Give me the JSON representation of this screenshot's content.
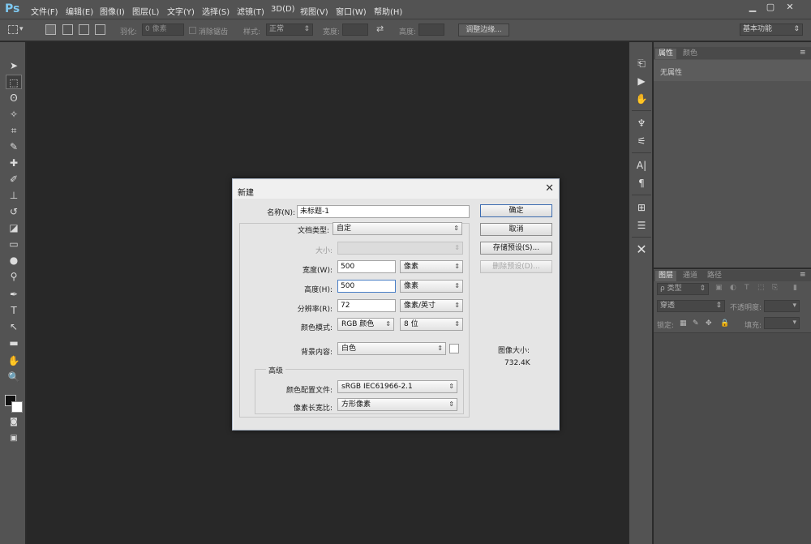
{
  "app": {
    "logo": "Ps",
    "menu": [
      "文件(F)",
      "编辑(E)",
      "图像(I)",
      "图层(L)",
      "文字(Y)",
      "选择(S)",
      "滤镜(T)",
      "3D(D)",
      "视图(V)",
      "窗口(W)",
      "帮助(H)"
    ],
    "window_buttons": [
      "▁",
      "▢",
      "✕"
    ]
  },
  "options_bar": {
    "feather_label": "羽化:",
    "feather_value": "0 像素",
    "antialias_label": "消除锯齿",
    "style_label": "样式:",
    "style_value": "正常",
    "width_label": "宽度:",
    "height_label": "高度:",
    "refine_edge_button": "调整边缘...",
    "workspace": "基本功能"
  },
  "right_panel": {
    "tabs_top": [
      "属性",
      "颜色"
    ],
    "properties_empty": "无属性",
    "tabs_layers": [
      "图层",
      "通道",
      "路径"
    ],
    "kind_filter": "ρ 类型",
    "blend_mode": "穿透",
    "opacity_label": "不透明度:",
    "lock_label": "锁定:",
    "fill_label": "填充:"
  },
  "dialog": {
    "title": "新建",
    "name_label": "名称(N):",
    "name_value": "未标题-1",
    "doc_type_label": "文档类型:",
    "doc_type_value": "自定",
    "size_label": "大小:",
    "width_label": "宽度(W):",
    "width_value": "500",
    "width_unit": "像素",
    "height_label": "高度(H):",
    "height_value": "500",
    "height_unit": "像素",
    "resolution_label": "分辨率(R):",
    "resolution_value": "72",
    "resolution_unit": "像素/英寸",
    "color_mode_label": "颜色模式:",
    "color_mode_value": "RGB 颜色",
    "bit_depth_value": "8 位",
    "background_label": "背景内容:",
    "background_value": "白色",
    "advanced_label": "高级",
    "color_profile_label": "颜色配置文件:",
    "color_profile_value": "sRGB IEC61966-2.1",
    "pixel_aspect_label": "像素长宽比:",
    "pixel_aspect_value": "方形像素",
    "ok_button": "确定",
    "cancel_button": "取消",
    "save_preset_button": "存储预设(S)...",
    "delete_preset_button": "删除预设(D)...",
    "image_size_label": "图像大小:",
    "image_size_value": "732.4K"
  },
  "colors": {
    "ui_gray": "#535353",
    "canvas": "#282828",
    "dialog_bg": "#e5e5e5",
    "logo": "#7ec8f0"
  }
}
